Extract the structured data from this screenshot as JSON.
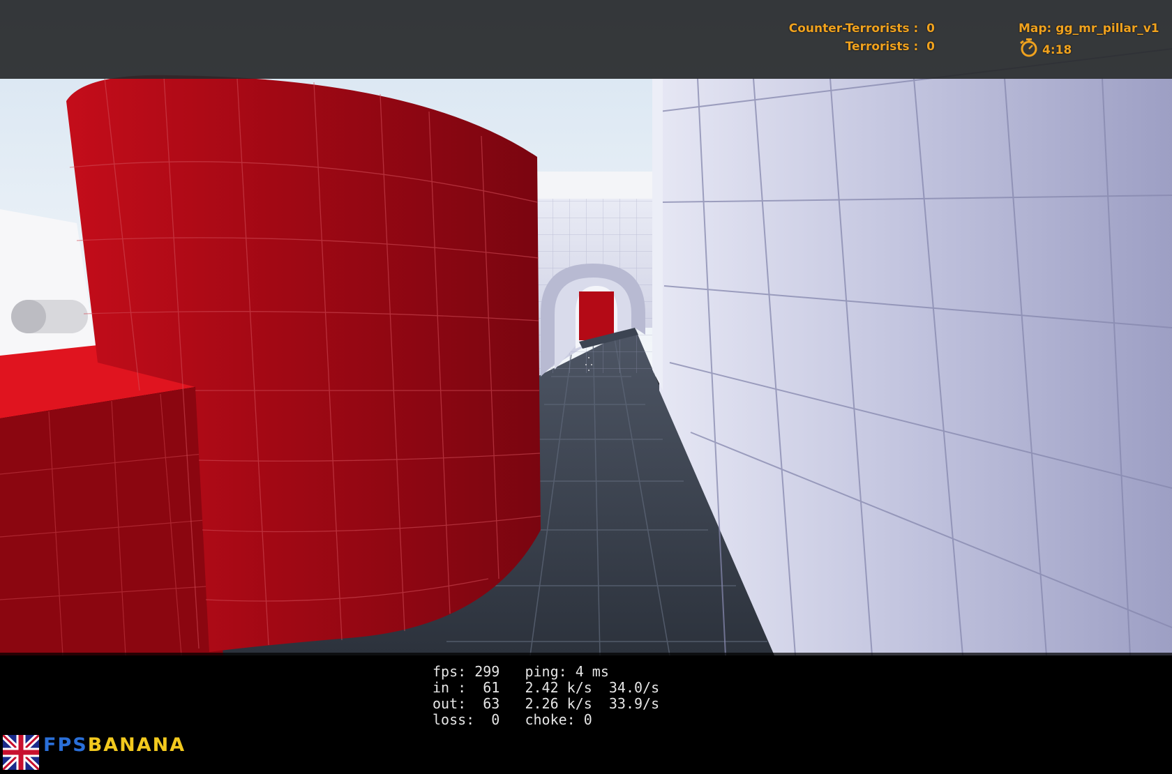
{
  "hud": {
    "ct_label": "Counter-Terrorists :",
    "ct_score": "0",
    "t_label": "Terrorists :",
    "t_score": "0",
    "map_label": "Map: gg_mr_pillar_v1",
    "timer": "4:18",
    "hud_color": "#f0a21e",
    "timer_icon": "stopwatch-icon"
  },
  "netgraph": {
    "line1": "fps: 299   ping: 4 ms",
    "line2": "in :  61   2.42 k/s  34.0/s",
    "line3": "out:  63   2.26 k/s  33.9/s",
    "line4": "loss:  0   choke: 0"
  },
  "watermark": {
    "part1": "FPS",
    "part2": "BANANA",
    "flag_icon": "union-jack-icon"
  },
  "scene": {
    "pillar_color": "#a80a14",
    "wall_color": "#c7c9e2",
    "floor_color": "#3a4250",
    "sky_color": "#dfe8f2"
  }
}
